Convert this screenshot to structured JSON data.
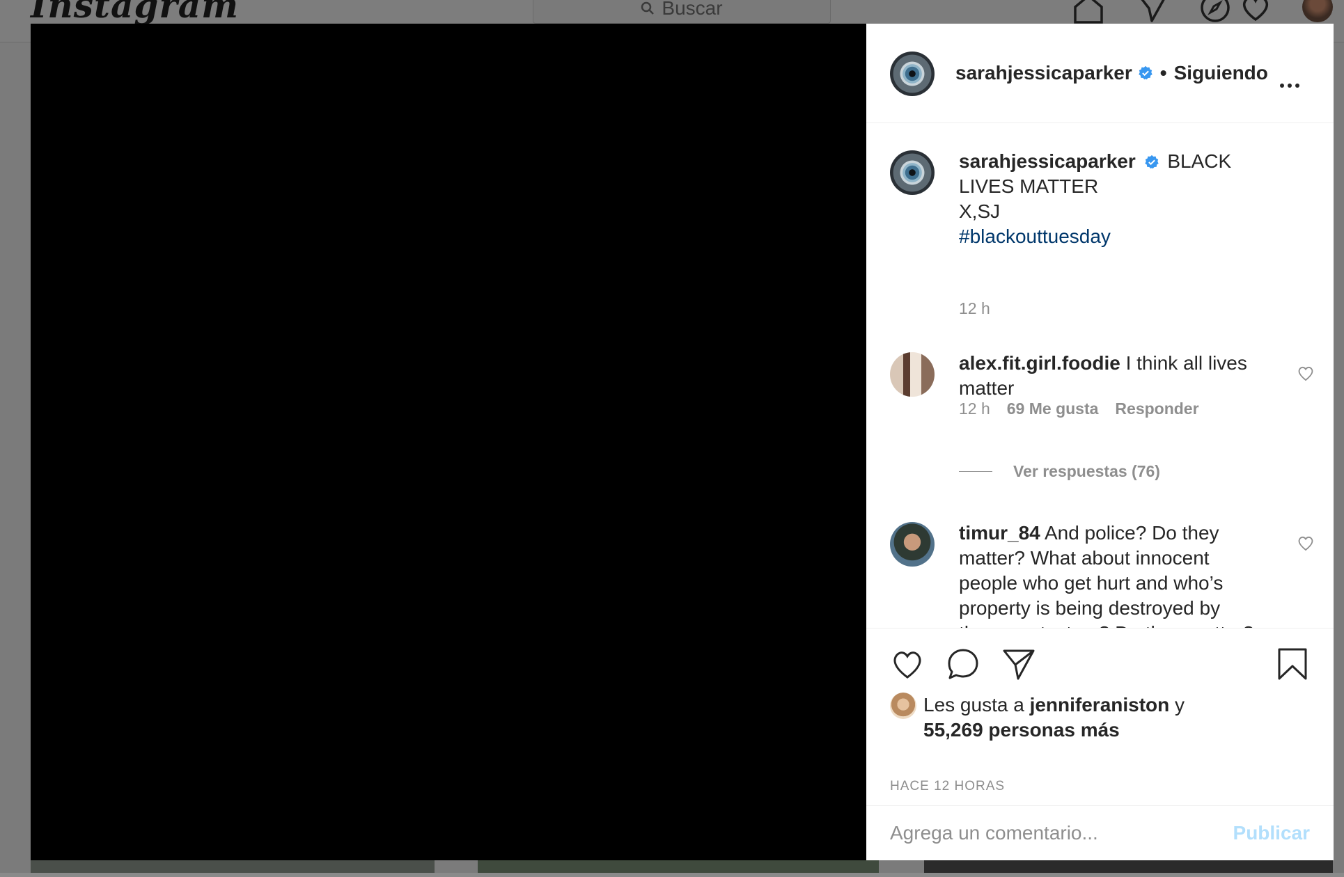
{
  "background": {
    "logo_text": "Instagram",
    "search_placeholder": "Buscar",
    "nav_icons": [
      "home-icon",
      "direct-icon",
      "explore-icon",
      "activity-heart-icon",
      "profile-avatar"
    ]
  },
  "post": {
    "header": {
      "username": "sarahjessicaparker",
      "separator": "•",
      "follow_status": "Siguiendo"
    },
    "caption": {
      "username": "sarahjessicaparker",
      "line1": "BLACK LIVES MATTER",
      "line2": "X,SJ",
      "hashtag": "#blackouttuesday",
      "time": "12 h"
    },
    "comments": [
      {
        "username": "alex.fit.girl.foodie",
        "text": "I think all lives matter",
        "time": "12 h",
        "likes": "69 Me gusta",
        "reply_label": "Responder",
        "view_replies": "Ver respuestas (76)"
      },
      {
        "username": "timur_84",
        "text": "And police? Do they matter? What about innocent people who get hurt and who’s property is being destroyed by those protesters? Do they matter?"
      }
    ],
    "actions": {
      "icons": [
        "like-heart-icon",
        "comment-icon",
        "share-icon",
        "save-bookmark-icon"
      ]
    },
    "likes": {
      "prefix": "Les gusta a",
      "liker": "jenniferaniston",
      "conjunction": "y",
      "others": "55,269 personas más"
    },
    "timestamp": "HACE 12 HORAS",
    "comment_box": {
      "placeholder": "Agrega un comentario...",
      "publish_label": "Publicar"
    }
  },
  "colors": {
    "accent_blue": "#3897f0",
    "hashtag": "#00376b",
    "muted": "#8e8e8e",
    "publish_disabled": "#b2dffc",
    "text": "#262626"
  }
}
